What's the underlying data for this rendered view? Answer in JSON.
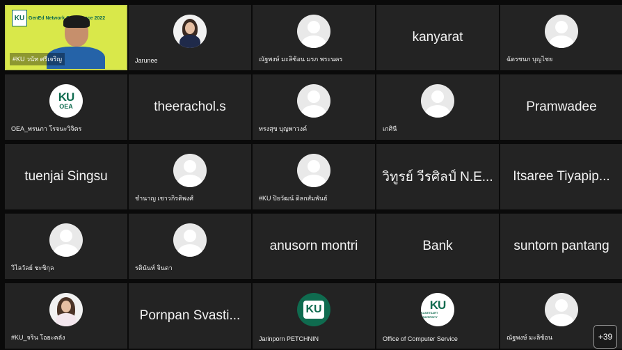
{
  "tiles": [
    {
      "kind": "video",
      "name": "#KU วนัท ศรีเจริญ",
      "banner_logo": "KU",
      "banner_text": "GenEd Network Conference 2022"
    },
    {
      "kind": "avatar-person",
      "name": "Jarunee"
    },
    {
      "kind": "avatar",
      "name": "ณัฐพงษ์ มะลิซ้อน มรภ พระนคร"
    },
    {
      "kind": "bigname",
      "name": "kanyarat"
    },
    {
      "kind": "avatar",
      "name": "ฉัตรชนก บุญไชย"
    },
    {
      "kind": "logo-oea",
      "name": "OEA_พรนภา โรจนะวิจิตร",
      "logo_top": "KU",
      "logo_bottom": "OEA"
    },
    {
      "kind": "bigname",
      "name": "theerachol.s"
    },
    {
      "kind": "avatar",
      "name": "ทรงสุข บุญพาวงค์"
    },
    {
      "kind": "avatar",
      "name": "เกศินี"
    },
    {
      "kind": "bigname",
      "name": "Pramwadee"
    },
    {
      "kind": "bigname",
      "name": "tuenjai Singsu"
    },
    {
      "kind": "avatar",
      "name": "ชำนาญ เชาวกิรติพงศ์"
    },
    {
      "kind": "avatar",
      "name": "#KU ปิยวัฒน์ ดิลกสัมพันธ์"
    },
    {
      "kind": "bigname",
      "name": "วิทูรย์ วีรศิลป์ N.E..."
    },
    {
      "kind": "bigname",
      "name": "Itsaree Tiyapip..."
    },
    {
      "kind": "avatar",
      "name": "วิไลวัลย์ ชะชิกุล"
    },
    {
      "kind": "avatar",
      "name": "รตินันท์ จินดา"
    },
    {
      "kind": "bigname",
      "name": "anusorn montri"
    },
    {
      "kind": "bigname",
      "name": "Bank"
    },
    {
      "kind": "bigname",
      "name": "suntorn pantang"
    },
    {
      "kind": "avatar-woman",
      "name": "#KU_จริน โอยะคลัง"
    },
    {
      "kind": "bigname",
      "name": "Pornpan Svasti..."
    },
    {
      "kind": "logo-green",
      "name": "Jarinporn PETCHNIN",
      "logo_top": "KU"
    },
    {
      "kind": "logo-ku",
      "name": "Office of Computer Service",
      "logo_top": "KU",
      "logo_bottom": "KASETSART UNIVERSITY"
    },
    {
      "kind": "avatar",
      "name": "ณัฐพงษ์ มะลิซ้อน"
    }
  ],
  "more_participants": "+39",
  "colors": {
    "tile_bg": "#232323",
    "page_bg": "#0a0a0a",
    "ku_green": "#0f6b4f",
    "video_bg": "#d9e84a"
  }
}
